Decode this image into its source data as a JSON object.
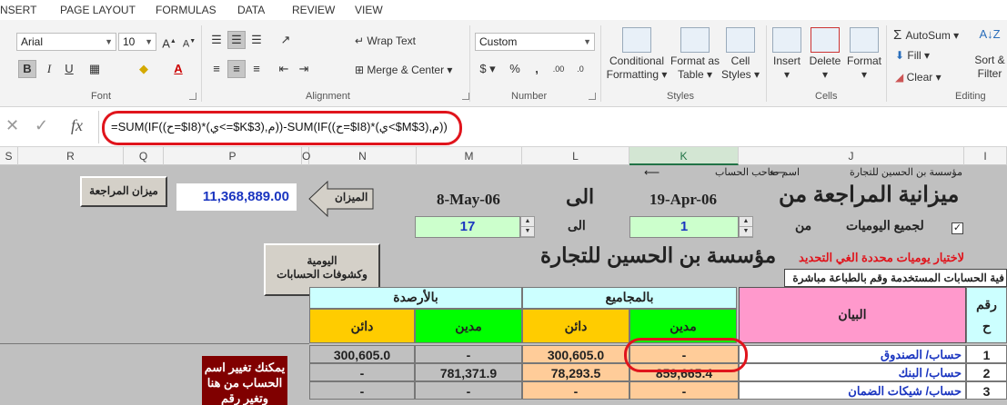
{
  "tabs": [
    "NSERT",
    "PAGE LAYOUT",
    "FORMULAS",
    "DATA",
    "REVIEW",
    "VIEW"
  ],
  "font": {
    "name": "Arial",
    "size": "10",
    "group_label": "Font"
  },
  "alignment": {
    "wrap_text": "Wrap Text",
    "merge_center": "Merge & Center",
    "group_label": "Alignment"
  },
  "number": {
    "format": "Custom",
    "group_label": "Number"
  },
  "styles": {
    "conditional": "Conditional",
    "formatting": "Formatting",
    "format_as": "Format as",
    "table": "Table",
    "cell": "Cell",
    "cell_styles": "Styles",
    "group_label": "Styles"
  },
  "cells": {
    "insert": "Insert",
    "delete": "Delete",
    "format": "Format",
    "group_label": "Cells"
  },
  "editing": {
    "autosum": "AutoSum",
    "fill": "Fill",
    "clear": "Clear",
    "sort": "Sort &",
    "filter": "Filter",
    "group_label": "Editing"
  },
  "formula": "=SUM(IF((ح=$I8)*(ي<=$K$3),م))-SUM(IF((ح=$I8)*(ي<$M$3),م))",
  "columns": [
    "S",
    "R",
    "Q",
    "P",
    "O",
    "N",
    "M",
    "L",
    "K",
    "J",
    "I"
  ],
  "sheet": {
    "title_main": "ميزانية المراجعة  من",
    "from_date": "19-Apr-06",
    "to_label": "الى",
    "to_date": "8-May-06",
    "from_spin": "1",
    "to_spin": "17",
    "to_small": "الى",
    "from_small": "من",
    "all_journals": "لجميع اليوميات",
    "company_header": "مؤسسة بن الحسين للتجارة",
    "account_owner": "اسم صاحب الحساب",
    "balance_btn": "ميزان المراجعة",
    "balance_value": "11,368,889.00",
    "balance_arrow": "الميزان",
    "company_big": "مؤسسة بن الحسين للتجارة",
    "select_journals": "لاختيار يوميات محددة الغي التحديد",
    "filter_note": "فية الحسابات المستخدمة وقم بالطباعة مباشرة",
    "daily_btn_1": "اليومية",
    "daily_btn_2": "وكشوفات الحسابات",
    "hdr_totals": "بالمجاميع",
    "hdr_balances": "بالأرصدة",
    "hdr_statement": "البيان",
    "hdr_number": "رقم",
    "hdr_h": "ح",
    "debit": "مدين",
    "credit": "دائن",
    "note_1": "يمكنك تغيير اسم",
    "note_2": "الحساب من هنا",
    "note_3": "وتغير رقم",
    "rows": [
      {
        "num": "1",
        "name": "حساب/ الصندوق",
        "debit_tot": "-",
        "credit_tot": "300,605.0",
        "debit_bal": "-",
        "credit_bal": "300,605.0"
      },
      {
        "num": "2",
        "name": "حساب/ البنك",
        "debit_tot": "859,665.4",
        "credit_tot": "78,293.5",
        "debit_bal": "781,371.9",
        "credit_bal": "-"
      },
      {
        "num": "3",
        "name": "حساب/ شيكات الضمان",
        "debit_tot": "-",
        "credit_tot": "-",
        "debit_bal": "-",
        "credit_bal": "-"
      }
    ]
  },
  "colors": {
    "green": "#00ff00",
    "yellow": "#ffcc00",
    "cyan": "#ccffff",
    "pink": "#ff99cc",
    "peach": "#ffcc99",
    "lightgreen": "#ccffcc",
    "highlight": "#e0141c"
  }
}
